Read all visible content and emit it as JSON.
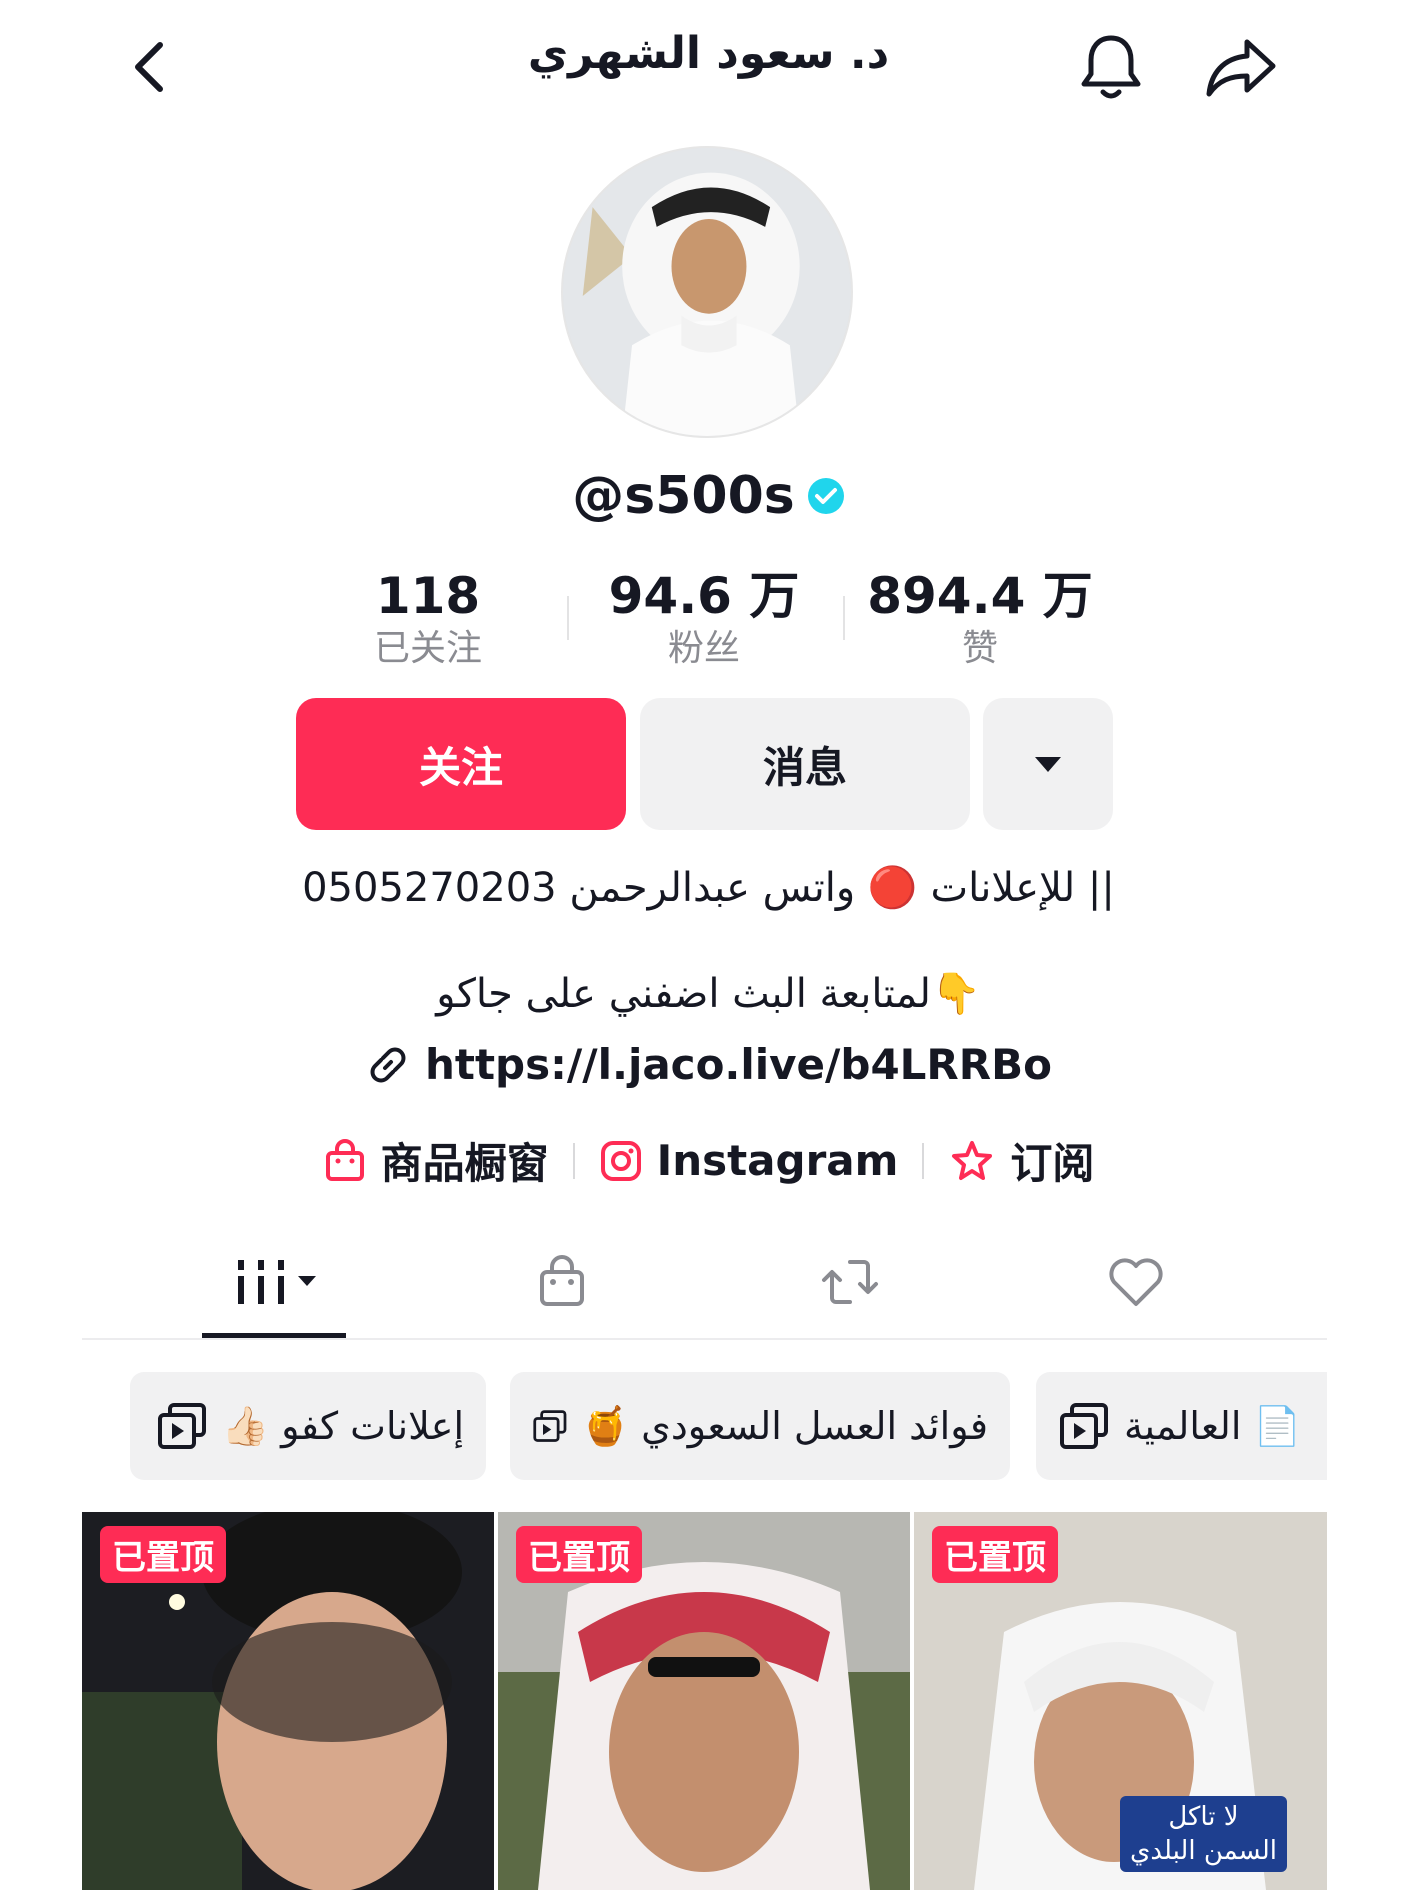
{
  "header": {
    "title": "د. سعود الشهري",
    "back_icon": "chevron-left-icon",
    "bell_icon": "bell-icon",
    "share_icon": "share-icon"
  },
  "profile": {
    "username": "@s500s",
    "verified": true,
    "stats": [
      {
        "value": "118",
        "label": "已关注"
      },
      {
        "value": "94.6 万",
        "label": "粉丝"
      },
      {
        "value": "894.4 万",
        "label": "赞"
      }
    ]
  },
  "actions": {
    "follow_label": "关注",
    "message_label": "消息"
  },
  "bio": {
    "line1": "للإعلانات 🔴 واتس عبدالرحمن 0505270203 ||",
    "line2": "لمتابعة البث اضفني على جاكو👇",
    "link": "https://l.jaco.live/b4LRRBo"
  },
  "links": {
    "shop_label": "商品橱窗",
    "instagram_label": "Instagram",
    "subscribe_label": "订阅"
  },
  "tabs": [
    "videos",
    "shop",
    "reposts",
    "liked"
  ],
  "playlists": [
    {
      "label": "إعلانات كفو 👍🏻"
    },
    {
      "label": "فوائد العسل السعودي 🍯"
    },
    {
      "label": "📄 العالمية"
    }
  ],
  "videos": [
    {
      "pinned_label": "已置顶"
    },
    {
      "pinned_label": "已置顶"
    },
    {
      "pinned_label": "已置顶",
      "caption_line1": "لا تاكل",
      "caption_line2": "السمن البلدي"
    }
  ],
  "colors": {
    "accent": "#fe2c55",
    "verified": "#20d5ec",
    "text": "#161823",
    "muted": "#8a8b91"
  }
}
